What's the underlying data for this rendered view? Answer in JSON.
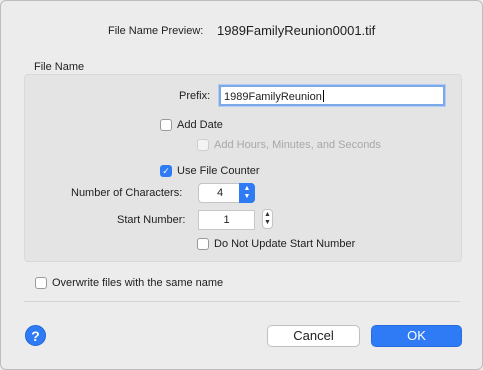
{
  "preview": {
    "label": "File Name Preview:",
    "value": "1989FamilyReunion0001.tif"
  },
  "section": {
    "title": "File Name"
  },
  "prefix": {
    "label": "Prefix:",
    "value": "1989FamilyReunion"
  },
  "add_date": {
    "label": "Add Date",
    "checked": false
  },
  "add_hms": {
    "label": "Add Hours, Minutes, and Seconds",
    "checked": false,
    "enabled": false
  },
  "file_counter": {
    "label": "Use File Counter",
    "checked": true
  },
  "num_chars": {
    "label": "Number of Characters:",
    "value": "4"
  },
  "start_number": {
    "label": "Start Number:",
    "value": "1"
  },
  "no_update": {
    "label": "Do Not Update Start Number",
    "checked": false
  },
  "overwrite": {
    "label": "Overwrite files with the same name",
    "checked": false
  },
  "buttons": {
    "cancel": "Cancel",
    "ok": "OK",
    "help": "?"
  },
  "colors": {
    "accent": "#2f7bf5",
    "background": "#ececec",
    "group_bg": "#e4e4e4"
  },
  "icons": {
    "help": "help-icon",
    "checkmark": "checkmark-icon",
    "popup_arrows": "chevron-updown-icon",
    "stepper": "stepper-icon"
  }
}
